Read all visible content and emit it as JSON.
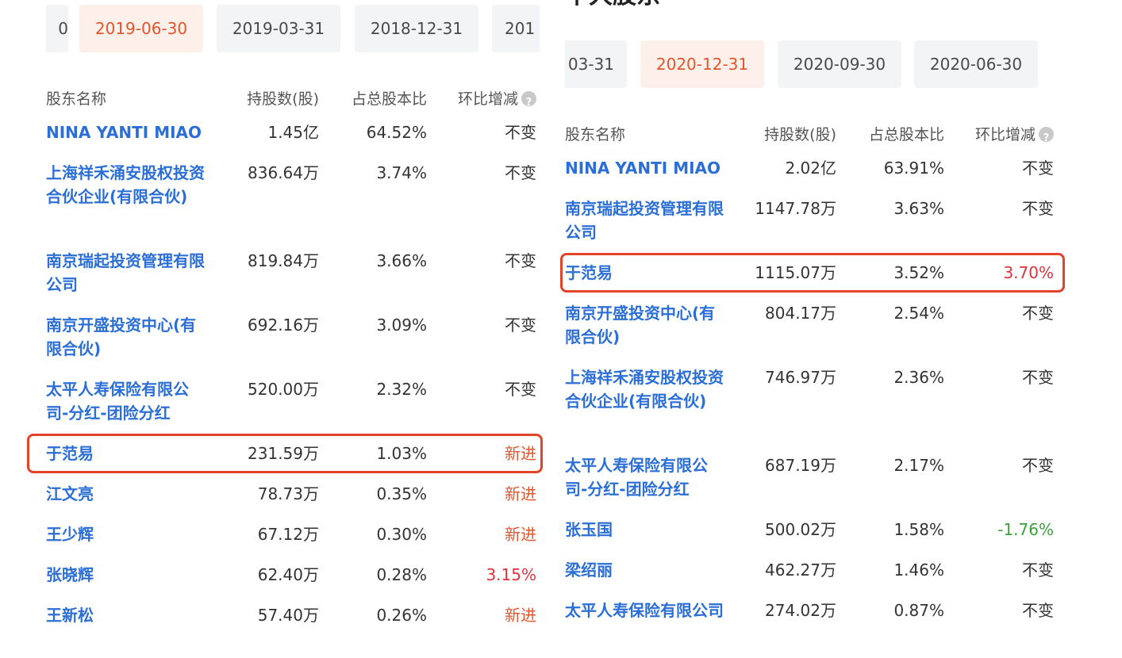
{
  "left": {
    "tabs": [
      {
        "label": "0",
        "active": false
      },
      {
        "label": "2019-06-30",
        "active": true
      },
      {
        "label": "2019-03-31",
        "active": false
      },
      {
        "label": "2018-12-31",
        "active": false
      },
      {
        "label": "201",
        "active": false
      }
    ],
    "headers": {
      "name": "股东名称",
      "shares": "持股数(股)",
      "ratio": "占总股本比",
      "change": "环比增减"
    },
    "rows": [
      {
        "name": "NINA YANTI MIAO",
        "shares": "1.45亿",
        "ratio": "64.52%",
        "change": "不变",
        "type": "unchanged",
        "lines": 1
      },
      {
        "name": "上海祥禾涌安股权投资合伙企业(有限合伙)",
        "shares": "836.64万",
        "ratio": "3.74%",
        "change": "不变",
        "type": "unchanged",
        "lines": 3
      },
      {
        "name": "南京瑞起投资管理有限公司",
        "shares": "819.84万",
        "ratio": "3.66%",
        "change": "不变",
        "type": "unchanged",
        "lines": 2
      },
      {
        "name": "南京开盛投资中心(有限合伙)",
        "shares": "692.16万",
        "ratio": "3.09%",
        "change": "不变",
        "type": "unchanged",
        "lines": 2
      },
      {
        "name": "太平人寿保险有限公司-分红-团险分红",
        "shares": "520.00万",
        "ratio": "2.32%",
        "change": "不变",
        "type": "unchanged",
        "lines": 2
      },
      {
        "name": "于范易",
        "shares": "231.59万",
        "ratio": "1.03%",
        "change": "新进",
        "type": "newin",
        "lines": 1,
        "highlight": true
      },
      {
        "name": "江文亮",
        "shares": "78.73万",
        "ratio": "0.35%",
        "change": "新进",
        "type": "newin",
        "lines": 1
      },
      {
        "name": "王少辉",
        "shares": "67.12万",
        "ratio": "0.30%",
        "change": "新进",
        "type": "newin",
        "lines": 1
      },
      {
        "name": "张晓辉",
        "shares": "62.40万",
        "ratio": "0.28%",
        "change": "3.15%",
        "type": "up",
        "lines": 1
      },
      {
        "name": "王新松",
        "shares": "57.40万",
        "ratio": "0.26%",
        "change": "新进",
        "type": "newin",
        "lines": 1
      }
    ]
  },
  "right": {
    "cut_title": "十大股东",
    "tabs": [
      {
        "label": "03-31",
        "active": false
      },
      {
        "label": "2020-12-31",
        "active": true
      },
      {
        "label": "2020-09-30",
        "active": false
      },
      {
        "label": "2020-06-30",
        "active": false
      }
    ],
    "headers": {
      "name": "股东名称",
      "shares": "持股数(股)",
      "ratio": "占总股本比",
      "change": "环比增减"
    },
    "rows": [
      {
        "name": "NINA YANTI MIAO",
        "shares": "2.02亿",
        "ratio": "63.91%",
        "change": "不变",
        "type": "unchanged",
        "lines": 1
      },
      {
        "name": "南京瑞起投资管理有限公司",
        "shares": "1147.78万",
        "ratio": "3.63%",
        "change": "不变",
        "type": "unchanged",
        "lines": 2
      },
      {
        "name": "于范易",
        "shares": "1115.07万",
        "ratio": "3.52%",
        "change": "3.70%",
        "type": "up",
        "lines": 1,
        "highlight": true
      },
      {
        "name": "南京开盛投资中心(有限合伙)",
        "shares": "804.17万",
        "ratio": "2.54%",
        "change": "不变",
        "type": "unchanged",
        "lines": 2
      },
      {
        "name": "上海祥禾涌安股权投资合伙企业(有限合伙)",
        "shares": "746.97万",
        "ratio": "2.36%",
        "change": "不变",
        "type": "unchanged",
        "lines": 3
      },
      {
        "name": "太平人寿保险有限公司-分红-团险分红",
        "shares": "687.19万",
        "ratio": "2.17%",
        "change": "不变",
        "type": "unchanged",
        "lines": 2
      },
      {
        "name": "张玉国",
        "shares": "500.02万",
        "ratio": "1.58%",
        "change": "-1.76%",
        "type": "down",
        "lines": 1
      },
      {
        "name": "梁绍丽",
        "shares": "462.27万",
        "ratio": "1.46%",
        "change": "不变",
        "type": "unchanged",
        "lines": 1
      },
      {
        "name": "太平人寿保险有限公司",
        "shares": "274.02万",
        "ratio": "0.87%",
        "change": "不变",
        "type": "unchanged",
        "lines": 2
      }
    ]
  }
}
